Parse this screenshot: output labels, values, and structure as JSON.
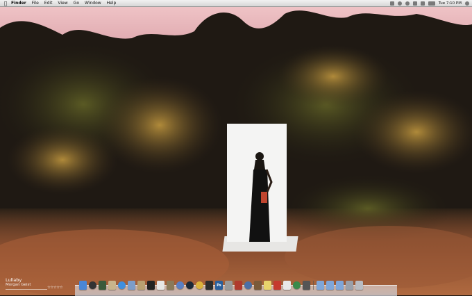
{
  "menubar": {
    "apple_icon": "apple-icon",
    "items": [
      {
        "label": "Finder"
      },
      {
        "label": "File"
      },
      {
        "label": "Edit"
      },
      {
        "label": "View"
      },
      {
        "label": "Go"
      },
      {
        "label": "Window"
      },
      {
        "label": "Help"
      }
    ],
    "clock": "Tue 7:10 PM",
    "status_icons": [
      "bluetooth-icon",
      "time-machine-icon",
      "sync-icon",
      "volume-icon",
      "wifi-icon",
      "battery-icon",
      "spotlight-icon"
    ]
  },
  "now_playing": {
    "title": "Lullaby",
    "artist": "Morgan Geist",
    "rating_stars": "☆☆☆☆☆"
  },
  "dock": {
    "icons": [
      {
        "name": "finder-icon",
        "color": "#4a86d6"
      },
      {
        "name": "dashboard-icon",
        "color": "#333333"
      },
      {
        "name": "photo-icon",
        "color": "#3b5a3b"
      },
      {
        "name": "preview-icon",
        "color": "#c9b48c"
      },
      {
        "name": "safari-icon",
        "color": "#3f8fe0"
      },
      {
        "name": "mail-icon",
        "color": "#7c9dc9"
      },
      {
        "name": "notes-icon",
        "color": "#b8a071"
      },
      {
        "name": "blackberry-icon",
        "color": "#222222"
      },
      {
        "name": "calendar-icon",
        "color": "#e6e6e6"
      },
      {
        "name": "contacts-icon",
        "color": "#8a7a5a"
      },
      {
        "name": "itunes-icon",
        "color": "#5a7fc4"
      },
      {
        "name": "steam-icon",
        "color": "#1b2838"
      },
      {
        "name": "chrome-icon",
        "color": "#dcb23c"
      },
      {
        "name": "camera-icon",
        "color": "#2d2d2d"
      },
      {
        "name": "photoshop-icon",
        "color": "#2b5f9c"
      },
      {
        "name": "pen-icon",
        "color": "#9a9a9a"
      },
      {
        "name": "filezilla-icon",
        "color": "#b03a2e"
      },
      {
        "name": "network-icon",
        "color": "#4b6fa6"
      },
      {
        "name": "brush-icon",
        "color": "#7a5a3a"
      },
      {
        "name": "sticky-icon",
        "color": "#e8d36c"
      },
      {
        "name": "flash-icon",
        "color": "#c53a2e"
      },
      {
        "name": "textedit-icon",
        "color": "#e8e8e8"
      },
      {
        "name": "globe-icon",
        "color": "#3a8a4a"
      },
      {
        "name": "activity-icon",
        "color": "#555555"
      },
      {
        "name": "applications-folder-icon",
        "color": "#7fa6d9"
      },
      {
        "name": "documents-folder-icon",
        "color": "#7fa6d9"
      },
      {
        "name": "downloads-folder-icon",
        "color": "#7fa6d9"
      },
      {
        "name": "drive-icon",
        "color": "#9aa0aa"
      },
      {
        "name": "trash-icon",
        "color": "#b9bcc2"
      }
    ],
    "photoshop_label": "Ps"
  }
}
